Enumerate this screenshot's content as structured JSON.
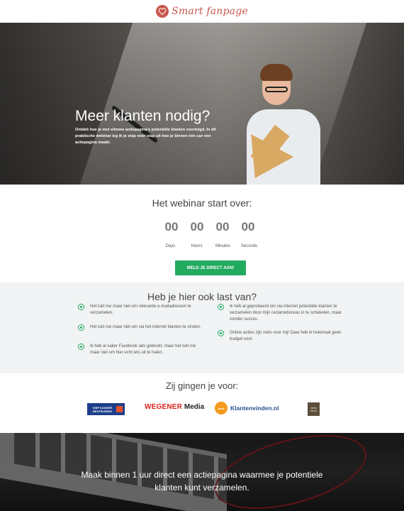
{
  "header": {
    "logo_text": "Smart fanpage",
    "logo_icon": "heart-s-icon"
  },
  "hero": {
    "title": "Meer klanten nodig?",
    "description": "Ontdek hoe je met slimme actiepagina's potentiële klanten overtuigd. In dit praktische webinar leg ik je stap voor stap uit hoe je binnen één uur een actiepagina maakt."
  },
  "countdown": {
    "title": "Het webinar start over:",
    "units": [
      {
        "value": "00",
        "label": "Days"
      },
      {
        "value": "00",
        "label": "Hours"
      },
      {
        "value": "00",
        "label": "Minutes"
      },
      {
        "value": "00",
        "label": "Seconds"
      }
    ],
    "cta_label": "MELD JE DIRECT AAN!"
  },
  "problems": {
    "title": "Heb je hier ook last van?",
    "left": [
      "Het lukt me maar niet om relevante e-mailadressen te verzamelen.",
      "Het lukt me maar niet om via het internet klanten te vinden.",
      "Ik heb al vaker Facebook ads gebruikt, maar het lukt me maar niet om hier echt iets uit te halen."
    ],
    "right": [
      "Ik heb al geprobeerd om via internet potentiële klanten te verzamelen door mijn reclamebureau in te schakelen, maar zonder succes.",
      "Online acties zijn niets voor mij! Daar heb ik helemaal geen budget voor."
    ]
  },
  "clients": {
    "title": "Zij gingen je voor:",
    "kbb_text": "KWF KANKER BESTRIJDING",
    "wegener_red": "WEGENER",
    "wegener_black": "Media",
    "kv_badge": "post",
    "kv_text": "Klantenvinden.nl",
    "opendeur_text": "OPEN DEUR"
  },
  "footer": {
    "text": "Maak binnen 1 uur direct een actiepagina waarmee je potentiele klanten kunt verzamelen."
  }
}
